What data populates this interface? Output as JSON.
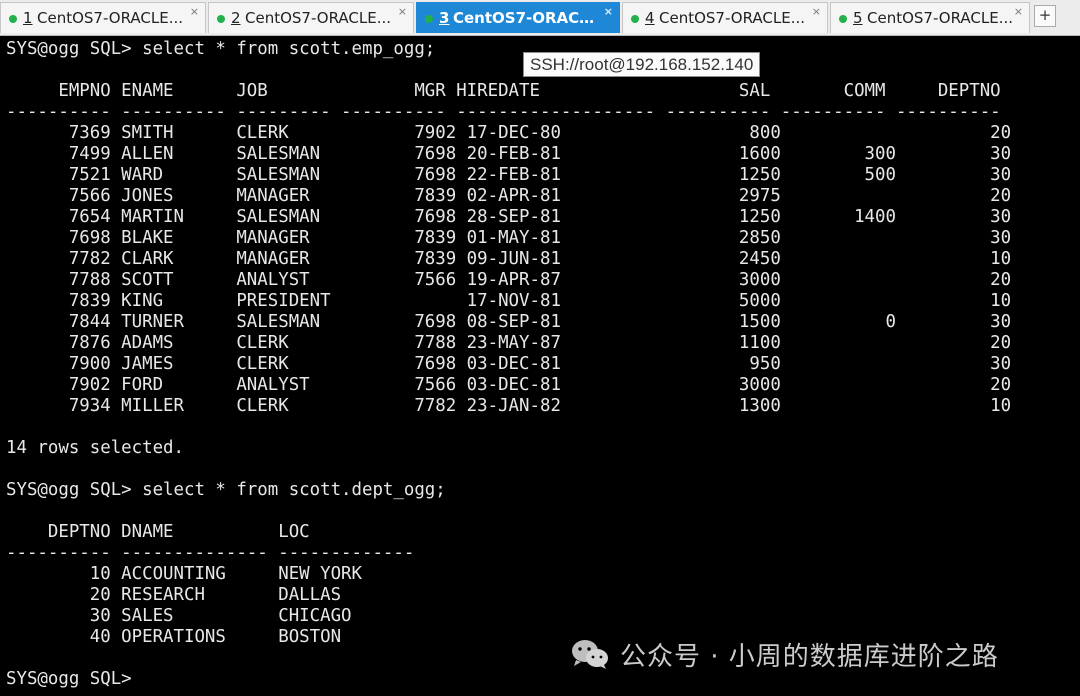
{
  "tabs": [
    {
      "number": "1",
      "title": "CentOS7-ORACLE...",
      "active": false
    },
    {
      "number": "2",
      "title": "CentOS7-ORACLE...",
      "active": false
    },
    {
      "number": "3",
      "title": "CentOS7-ORACLE...",
      "active": true
    },
    {
      "number": "4",
      "title": "CentOS7-ORACLE...",
      "active": false
    },
    {
      "number": "5",
      "title": "CentOS7-ORACLE...",
      "active": false
    }
  ],
  "tab_close_symbol": "×",
  "new_tab_symbol": "+",
  "tooltip": "SSH://root@192.168.152.140",
  "terminal": {
    "lines": [
      "SYS@ogg SQL> select * from scott.emp_ogg;",
      "",
      "     EMPNO ENAME      JOB              MGR HIREDATE                   SAL       COMM     DEPTNO",
      "---------- ---------- --------- ---------- ------------------- ---------- ---------- ----------",
      "      7369 SMITH      CLERK            7902 17-DEC-80                  800                    20",
      "      7499 ALLEN      SALESMAN         7698 20-FEB-81                 1600        300         30",
      "      7521 WARD       SALESMAN         7698 22-FEB-81                 1250        500         30",
      "      7566 JONES      MANAGER          7839 02-APR-81                 2975                    20",
      "      7654 MARTIN     SALESMAN         7698 28-SEP-81                 1250       1400         30",
      "      7698 BLAKE      MANAGER          7839 01-MAY-81                 2850                    30",
      "      7782 CLARK      MANAGER          7839 09-JUN-81                 2450                    10",
      "      7788 SCOTT      ANALYST          7566 19-APR-87                 3000                    20",
      "      7839 KING       PRESIDENT             17-NOV-81                 5000                    10",
      "      7844 TURNER     SALESMAN         7698 08-SEP-81                 1500          0         30",
      "      7876 ADAMS      CLERK            7788 23-MAY-87                 1100                    20",
      "      7900 JAMES      CLERK            7698 03-DEC-81                  950                    30",
      "      7902 FORD       ANALYST          7566 03-DEC-81                 3000                    20",
      "      7934 MILLER     CLERK            7782 23-JAN-82                 1300                    10",
      "",
      "14 rows selected.",
      "",
      "SYS@ogg SQL> select * from scott.dept_ogg;",
      "",
      "    DEPTNO DNAME          LOC",
      "---------- -------------- -------------",
      "        10 ACCOUNTING     NEW YORK",
      "        20 RESEARCH       DALLAS",
      "        30 SALES          CHICAGO",
      "        40 OPERATIONS     BOSTON",
      "",
      "SYS@ogg SQL>"
    ]
  },
  "watermark": "公众号 · 小周的数据库进阶之路",
  "colors": {
    "active_tab": "#1e88d6",
    "status_dot": "#22b14c",
    "terminal_bg": "#000000",
    "terminal_fg": "#e8e8e8"
  },
  "icons": {
    "watermark_logo": "wechat-icon"
  }
}
